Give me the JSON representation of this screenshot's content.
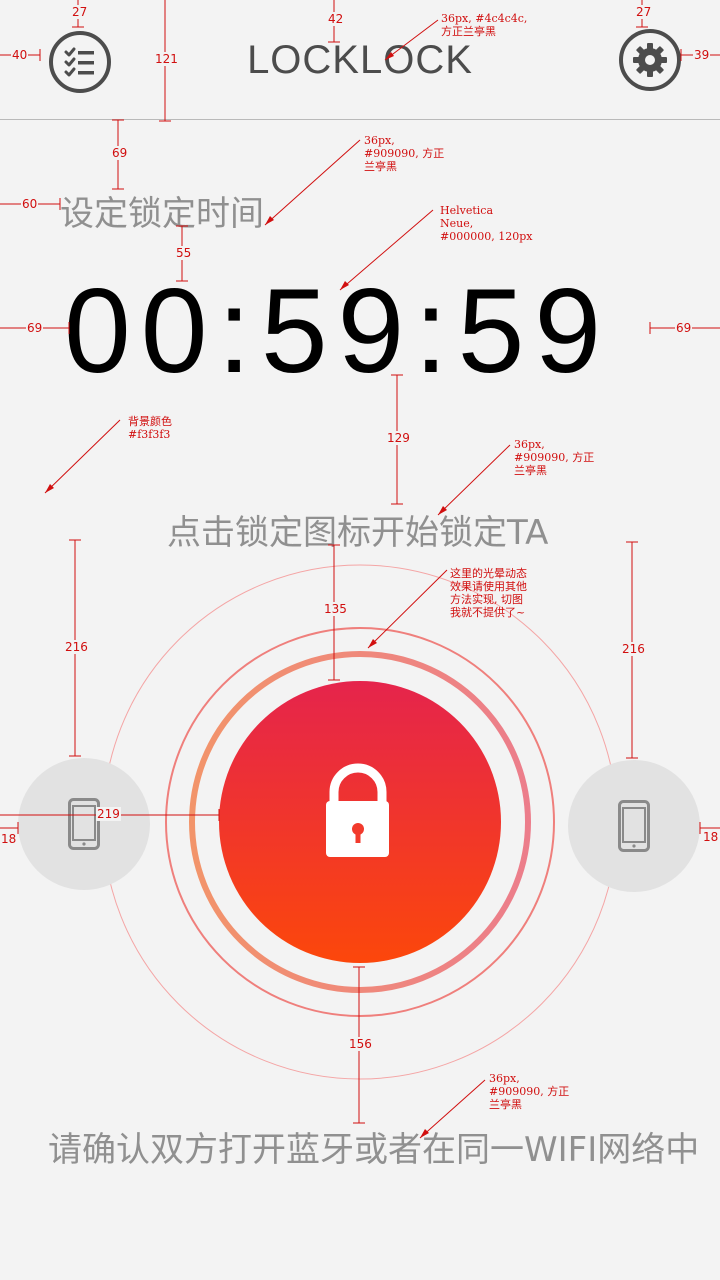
{
  "header": {
    "title": "LOCKLOCK",
    "list_icon": "checklist-icon",
    "settings_icon": "gear-icon"
  },
  "set_time_label": "设定锁定时间",
  "timer": "00:59:59",
  "instruction": "点击锁定图标开始锁定TA",
  "bottom_hint": "请确认双方打开蓝牙或者在同一WIFI网络中",
  "lock_icon": "padlock-icon",
  "left_device_icon": "phone-icon",
  "right_device_icon": "phone-icon",
  "colors": {
    "background": "#f3f3f3",
    "title": "#4c4c4c",
    "gray_text": "#909090",
    "timer": "#000000",
    "gradient_top": "#e5244c",
    "gradient_bottom": "#fc470b",
    "annotation": "#d10f0f"
  },
  "annotations": {
    "title_font": "36px, #4c4c4c,\n方正兰亭黑",
    "label_font": "36px,\n#909090, 方正\n兰亭黑",
    "timer_font": "Helvetica\nNeue,\n#000000, 120px",
    "bg_color": "背景颜色\n#f3f3f3",
    "instr_font": "36px,\n#909090, 方正\n兰亭黑",
    "halo_note": "这里的光晕动态\n效果请使用其他\n方法实现, 切图\n我就不提供了~",
    "hint_font": "36px,\n#909090, 方正\n兰亭黑"
  },
  "measures": {
    "m27a": "27",
    "m42": "42",
    "m27b": "27",
    "m40": "40",
    "m121": "121",
    "m39": "39",
    "m69a": "69",
    "m60": "60",
    "m55": "55",
    "m69b": "69",
    "m69c": "69",
    "m129": "129",
    "m216a": "216",
    "m135": "135",
    "m216b": "216",
    "m219": "219",
    "m18a": "18",
    "m18b": "18",
    "m156": "156"
  }
}
